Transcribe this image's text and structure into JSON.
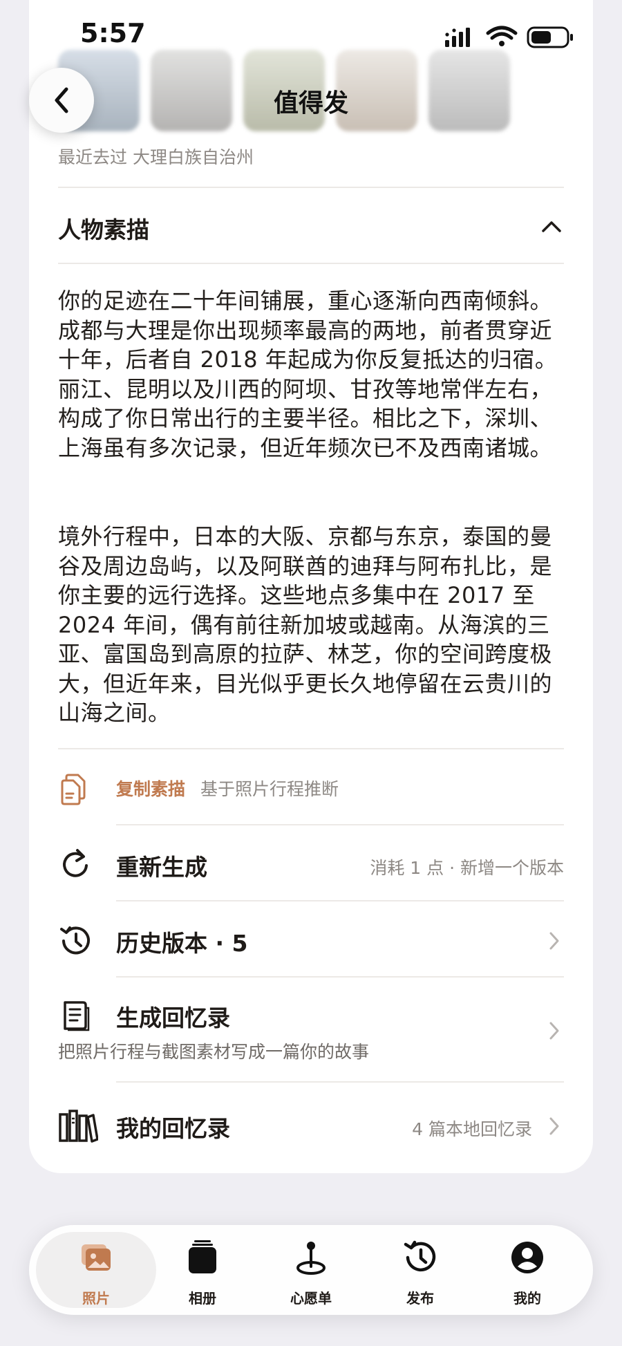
{
  "nav": {
    "title": "值得发"
  },
  "status": {
    "time": "5:57"
  },
  "recent": "最近去过 大理白族自治州",
  "section": {
    "title": "人物素描"
  },
  "sketch": {
    "p1": "你的足迹在二十年间铺展，重心逐渐向西南倾斜。成都与大理是你出现频率最高的两地，前者贯穿近十年，后者自 2018 年起成为你反复抵达的归宿。丽江、昆明以及川西的阿坝、甘孜等地常伴左右，构成了你日常出行的主要半径。相比之下，深圳、上海虽有多次记录，但近年频次已不及西南诸城。",
    "p2": "境外行程中，日本的大阪、京都与东京，泰国的曼谷及周边岛屿，以及阿联酋的迪拜与阿布扎比，是你主要的远行选择。这些地点多集中在 2017 至 2024 年间，偶有前往新加坡或越南。从海滨的三亚、富国岛到高原的拉萨、林芝，你的空间跨度极大，但近年来，目光似乎更长久地停留在云贵川的山海之间。"
  },
  "copy": {
    "label": "复制素描",
    "hint": "基于照片行程推断"
  },
  "actions": {
    "regenerate": {
      "title": "重新生成",
      "detail": "消耗 1 点 · 新增一个版本"
    },
    "history": {
      "title": "历史版本 · 5"
    },
    "memoir": {
      "title": "生成回忆录",
      "subtitle": "把照片行程与截图素材写成一篇你的故事"
    },
    "my_memoirs": {
      "title": "我的回忆录",
      "detail": "4 篇本地回忆录"
    }
  },
  "tabbar": {
    "active": "photos",
    "items": [
      {
        "id": "photos",
        "label": "照片",
        "icon": "photos-icon"
      },
      {
        "id": "albums",
        "label": "相册",
        "icon": "albums-icon"
      },
      {
        "id": "wishlist",
        "label": "心愿单",
        "icon": "location-pin-icon"
      },
      {
        "id": "publish",
        "label": "发布",
        "icon": "history-icon"
      },
      {
        "id": "mine",
        "label": "我的",
        "icon": "profile-icon"
      }
    ]
  },
  "colors": {
    "accent": "#c07a4f",
    "text": "#1f1b18",
    "muted": "#8d8884",
    "background": "#efeef3"
  }
}
